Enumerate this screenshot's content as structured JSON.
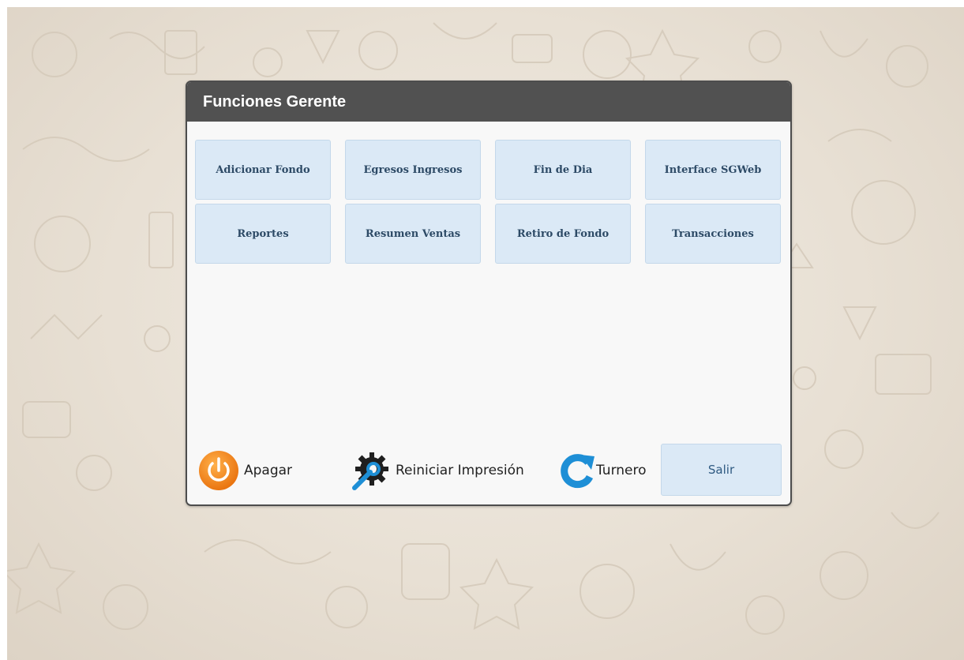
{
  "dialog": {
    "title": "Funciones Gerente"
  },
  "functions": [
    {
      "label": "Adicionar Fondo"
    },
    {
      "label": "Egresos Ingresos"
    },
    {
      "label": "Fin de Dia"
    },
    {
      "label": "Interface SGWeb"
    },
    {
      "label": "Reportes"
    },
    {
      "label": "Resumen Ventas"
    },
    {
      "label": "Retiro de Fondo"
    },
    {
      "label": "Transacciones"
    }
  ],
  "footer": {
    "apagar": {
      "label": "Apagar",
      "icon": "power-icon",
      "color": "#f0841c"
    },
    "reiniciar": {
      "label": "Reiniciar Impresión",
      "icon": "wrench-gear-icon",
      "color": "#1e8fd6"
    },
    "turnero": {
      "label": "Turnero",
      "icon": "refresh-icon",
      "color": "#1e8fd6"
    },
    "salir": {
      "label": "Salir"
    }
  },
  "colors": {
    "header_bg": "#515151",
    "button_bg": "#dbe9f6",
    "button_text": "#2d4a66"
  }
}
